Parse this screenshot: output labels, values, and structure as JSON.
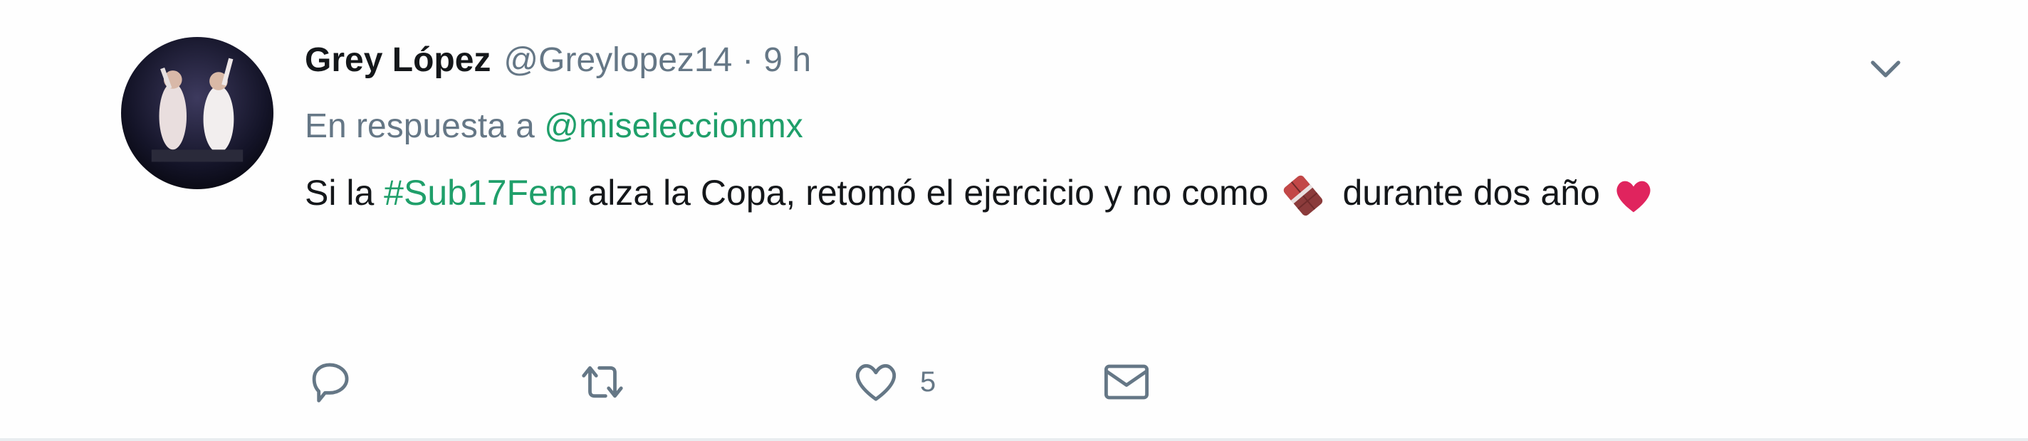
{
  "tweet": {
    "author": {
      "display_name": "Grey López",
      "handle": "@Greylopez14",
      "separator": "·",
      "time": "9 h"
    },
    "reply": {
      "prefix": "En respuesta a",
      "mention": "@miseleccionmx"
    },
    "text": {
      "part1": "Si la ",
      "hashtag": "#Sub17Fem",
      "part2": " alza la Copa, retomó el ejercicio y no como",
      "emoji1": "chocolate-bar-icon",
      "part3": "durante dos año",
      "emoji2": "red-heart-icon"
    },
    "actions": {
      "reply": {
        "icon": "reply-icon",
        "count": ""
      },
      "retweet": {
        "icon": "retweet-icon",
        "count": ""
      },
      "like": {
        "icon": "heart-icon",
        "count": "5"
      },
      "message": {
        "icon": "envelope-icon"
      }
    },
    "menu_icon": "chevron-down-icon",
    "colors": {
      "link": "#1f9f6a",
      "muted": "#657786",
      "text": "#14171a",
      "heart": "#e0245e"
    }
  }
}
